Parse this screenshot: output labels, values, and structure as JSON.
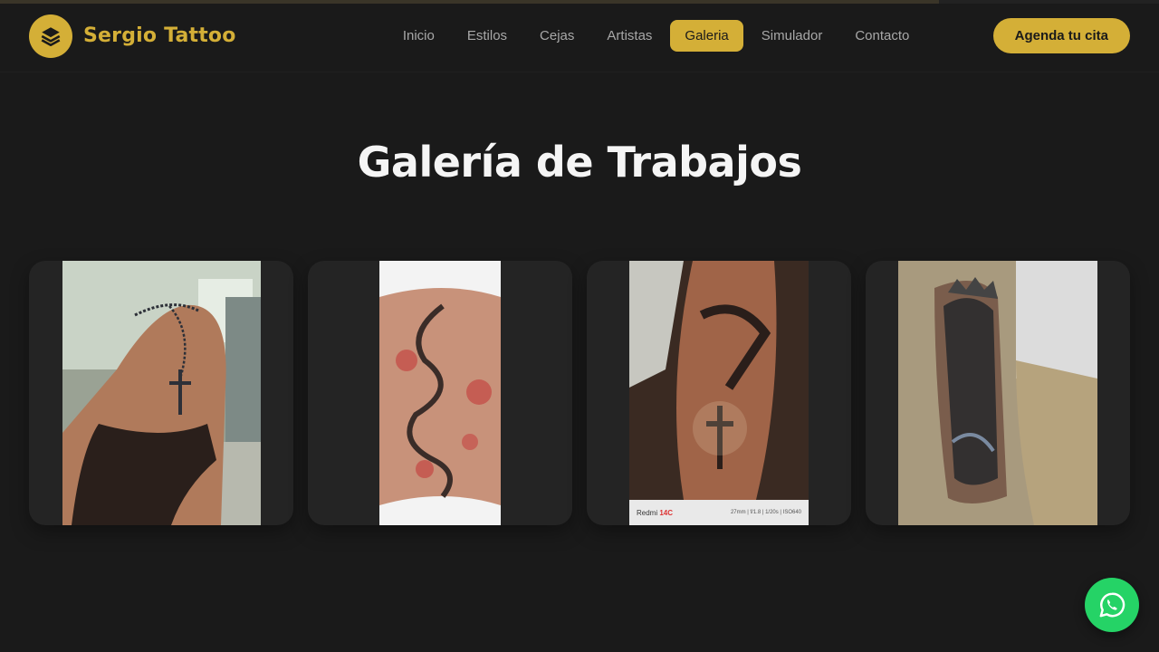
{
  "brand": {
    "name": "Sergio Tattoo",
    "logo_icon": "layers-icon",
    "color": "#d4af37"
  },
  "scroll_progress": 0.81,
  "nav": {
    "items": [
      {
        "label": "Inicio",
        "active": false
      },
      {
        "label": "Estilos",
        "active": false
      },
      {
        "label": "Cejas",
        "active": false
      },
      {
        "label": "Artistas",
        "active": false
      },
      {
        "label": "Galeria",
        "active": true
      },
      {
        "label": "Simulador",
        "active": false
      },
      {
        "label": "Contacto",
        "active": false
      }
    ]
  },
  "cta": {
    "label": "Agenda tu cita"
  },
  "section": {
    "title": "Galería de Trabajos"
  },
  "gallery": {
    "items": [
      {
        "subject": "rosary-shoulder-tattoo"
      },
      {
        "subject": "dragon-back-tattoo"
      },
      {
        "subject": "dove-cross-forearm-tattoo"
      },
      {
        "subject": "crown-forearm-sleeve-tattoo"
      }
    ],
    "camera_watermark": {
      "model_prefix": "Redmi",
      "model_suffix": "14C",
      "specs": "27mm | f/1.8 | 1/20s | ISO640"
    }
  },
  "whatsapp": {
    "icon": "whatsapp-icon",
    "color": "#25d366"
  }
}
